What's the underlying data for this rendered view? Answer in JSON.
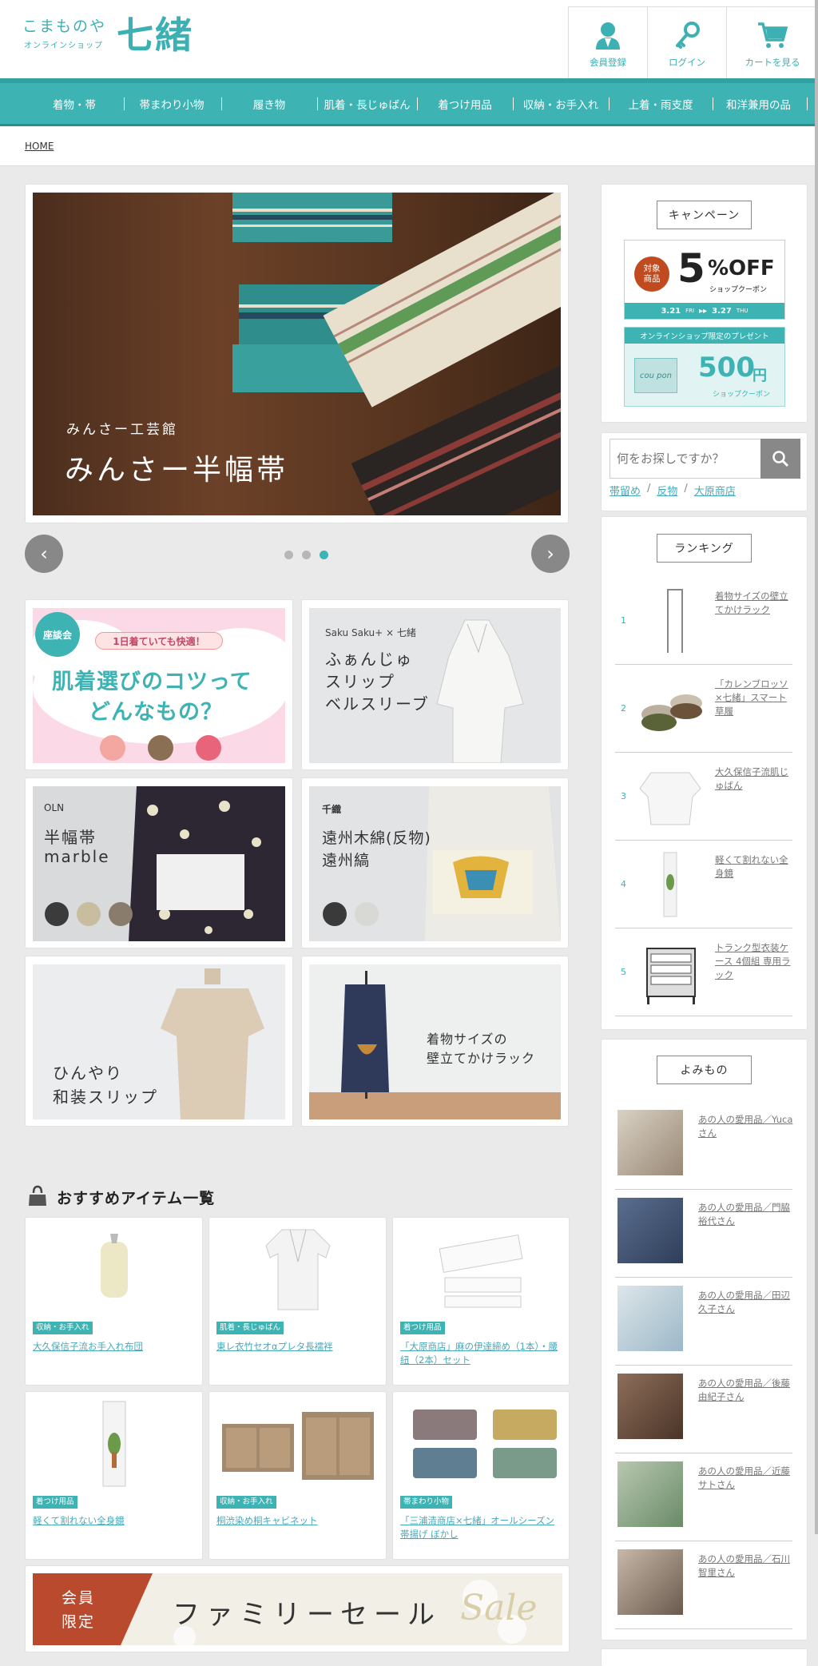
{
  "header": {
    "logo_line1": "こまものや",
    "logo_line2": "オンラインショップ",
    "logo_main": "七緒",
    "buttons": [
      {
        "label": "会員登録",
        "icon": "member-icon"
      },
      {
        "label": "ログイン",
        "icon": "key-icon"
      },
      {
        "label": "カートを見る",
        "icon": "cart-icon"
      }
    ]
  },
  "nav": {
    "items": [
      "着物・帯",
      "帯まわり小物",
      "履き物",
      "肌着・長じゅばん",
      "着つけ用品",
      "収納・お手入れ",
      "上着・雨支度",
      "和洋兼用の品"
    ]
  },
  "breadcrumb": {
    "home": "HOME"
  },
  "hero": {
    "subtitle": "みんさー工芸館",
    "title": "みんさー半幅帯",
    "prev": "‹",
    "next": "›",
    "slide_count": 3,
    "active_slide": 3
  },
  "banners": [
    {
      "badge": "座談会",
      "catch": "1日着ていても快適！",
      "title1": "肌着選びのコツって",
      "title2": "どんなもの？"
    },
    {
      "brand": "Saku Saku+ × 七緒",
      "l1": "ふぁんじゅ",
      "l2": "スリップ",
      "l3": "ベルスリーブ"
    },
    {
      "brand": "OLN",
      "l1": "半幅帯",
      "l2": "marble"
    },
    {
      "brand": "千織",
      "l1": "遠州木綿(反物)",
      "l2": "遠州縞"
    },
    {
      "l1": "ひんやり",
      "l2": "和装スリップ"
    },
    {
      "l1": "着物サイズの",
      "l2": "壁立てかけラック"
    }
  ],
  "recommend": {
    "title": "おすすめアイテム一覧",
    "items": [
      {
        "tag": "収納・お手入れ",
        "name": "大久保信子流お手入れ布団"
      },
      {
        "tag": "肌着・長じゅばん",
        "name": "東レ衣竹セオαプレタ長襦袢"
      },
      {
        "tag": "着つけ用品",
        "name": "「大原商店」麻の伊達締め（1本）・腰紐（2本）セット"
      },
      {
        "tag": "着つけ用品",
        "name": "軽くて割れない全身鏡"
      },
      {
        "tag": "収納・お手入れ",
        "name": "桐渋染め桐キャビネット"
      },
      {
        "tag": "帯まわり小物",
        "name": "「三浦清商店×七緒」オールシーズン帯揚げ ぼかし"
      }
    ]
  },
  "family_sale": {
    "badge1": "会員",
    "badge2": "限定",
    "title": "ファミリーセール",
    "script": "Sale"
  },
  "sidebar": {
    "campaign": {
      "title": "キャンペーン",
      "badge1": "対象",
      "badge2": "商品",
      "big": "5",
      "off": "%OFF",
      "coupon": "ショップクーポン",
      "date1": "3.21",
      "dow1": "FRI",
      "date2": "3.27",
      "dow2": "THU",
      "gift": "オンラインショップ限定のプレゼント",
      "amount": "500",
      "yen": "円",
      "coupon2": "ショップクーポン",
      "couponword": "cou pon"
    },
    "search": {
      "placeholder": "何をお探しですか？",
      "tags": [
        "帯留め",
        "反物",
        "大原商店"
      ],
      "sep": "/"
    },
    "ranking": {
      "title": "ランキング",
      "items": [
        {
          "num": "1",
          "name": "着物サイズの壁立てかけラック"
        },
        {
          "num": "2",
          "name": "「カレンブロッソ×七緒」スマート草履"
        },
        {
          "num": "3",
          "name": "大久保信子流肌じゅばん"
        },
        {
          "num": "4",
          "name": "軽くて割れない全身鏡"
        },
        {
          "num": "5",
          "name": "トランク型衣装ケース 4個組 専用ラック"
        }
      ]
    },
    "yomimono": {
      "title": "よみもの",
      "items": [
        {
          "name": "あの人の愛用品／Yucaさん"
        },
        {
          "name": "あの人の愛用品／門脇裕代さん"
        },
        {
          "name": "あの人の愛用品／田辺久子さん"
        },
        {
          "name": "あの人の愛用品／後藤由紀子さん"
        },
        {
          "name": "あの人の愛用品／近藤サトさん"
        },
        {
          "name": "あの人の愛用品／石川智里さん"
        }
      ]
    }
  }
}
